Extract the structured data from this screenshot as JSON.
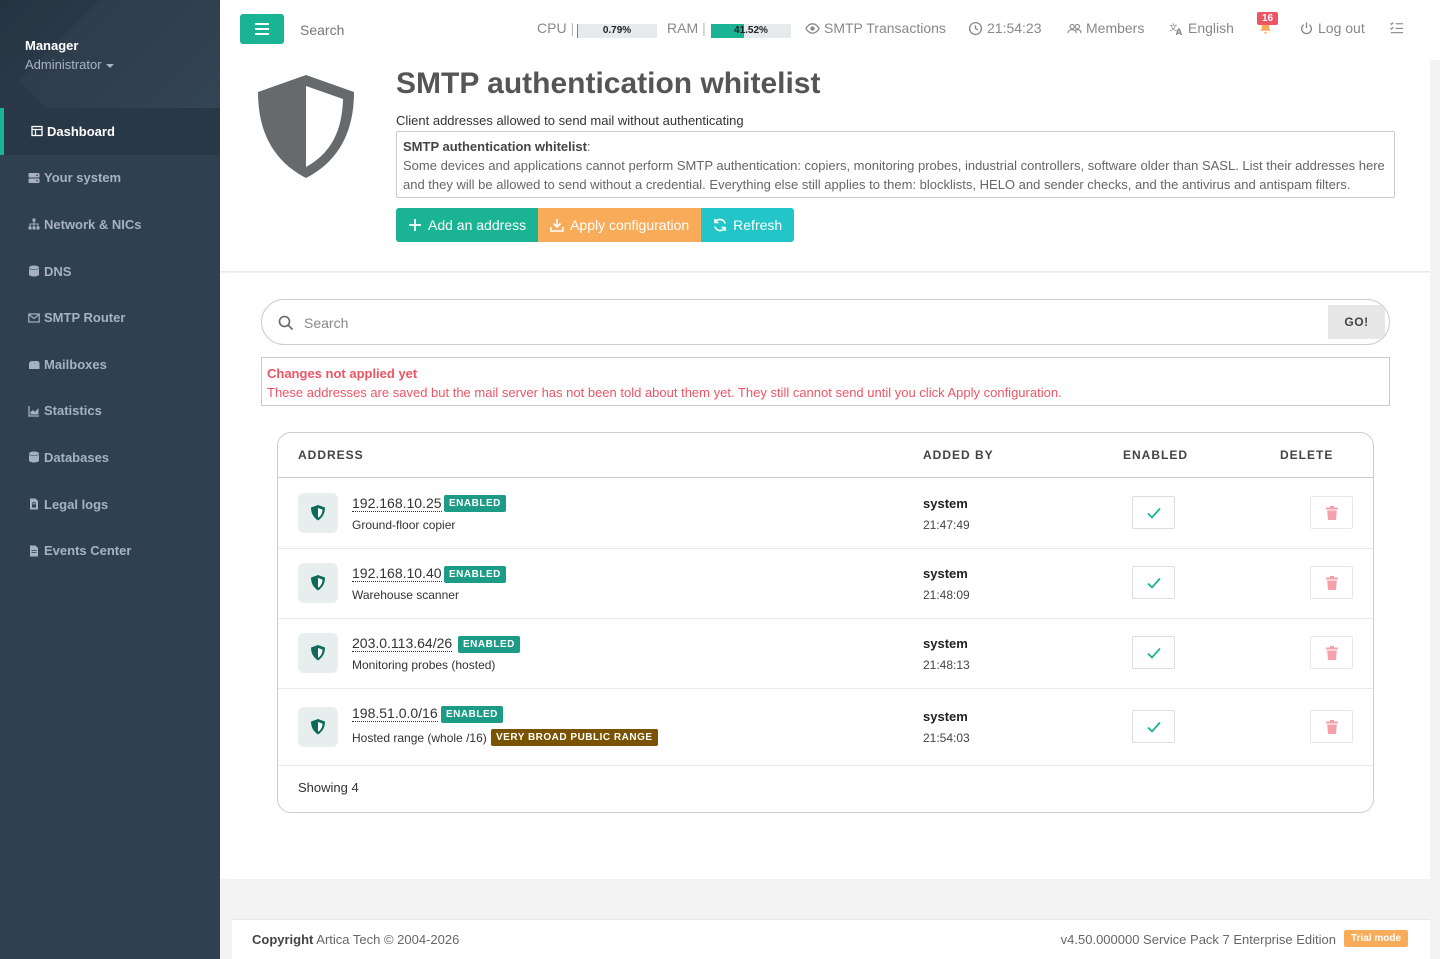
{
  "sidebar": {
    "user_name": "Manager",
    "user_role": "Administrator",
    "items": [
      {
        "label": "Dashboard",
        "icon": "dashboard-icon"
      },
      {
        "label": "Your system",
        "icon": "server-icon"
      },
      {
        "label": "Network & NICs",
        "icon": "network-icon"
      },
      {
        "label": "DNS",
        "icon": "database-icon"
      },
      {
        "label": "SMTP Router",
        "icon": "envelope-icon"
      },
      {
        "label": "Mailboxes",
        "icon": "mailbox-icon"
      },
      {
        "label": "Statistics",
        "icon": "chart-icon"
      },
      {
        "label": "Databases",
        "icon": "database-icon"
      },
      {
        "label": "Legal logs",
        "icon": "file-lock-icon"
      },
      {
        "label": "Events Center",
        "icon": "file-icon"
      }
    ]
  },
  "topbar": {
    "search_placeholder": "Search",
    "cpu_label": "CPU",
    "cpu_value": "0.79%",
    "cpu_fraction": 0.0079,
    "ram_label": "RAM",
    "ram_value": "41.52%",
    "ram_fraction": 0.4152,
    "smtp_transactions": "SMTP Transactions",
    "clock": "21:54:23",
    "members": "Members",
    "language": "English",
    "notifications": "16",
    "logout": "Log out"
  },
  "header": {
    "title": "SMTP authentication whitelist",
    "subtitle": "Client addresses allowed to send mail without authenticating",
    "explain_title": "SMTP authentication whitelist",
    "explain_text": "Some devices and applications cannot perform SMTP authentication: copiers, monitoring probes, industrial controllers, software older than SASL. List their addresses here and they will be allowed to send without a credential. Everything else still applies to them: blocklists, HELO and sender checks, and the antivirus and antispam filters.",
    "btn_add": "Add an address",
    "btn_apply": "Apply configuration",
    "btn_refresh": "Refresh"
  },
  "search": {
    "placeholder": "Search",
    "go_label": "GO!"
  },
  "alert": {
    "title": "Changes not applied yet",
    "text": "These addresses are saved but the mail server has not been told about them yet. They still cannot send until you click Apply configuration."
  },
  "table": {
    "headers": {
      "address": "ADDRESS",
      "added_by": "ADDED BY",
      "enabled": "ENABLED",
      "delete": "DELETE"
    },
    "rows": [
      {
        "address": "192.168.10.25",
        "badge": "ENABLED",
        "desc": "Ground-floor copier",
        "by": "system",
        "time": "21:47:49"
      },
      {
        "address": "192.168.10.40",
        "badge": "ENABLED",
        "desc": "Warehouse scanner",
        "by": "system",
        "time": "21:48:09"
      },
      {
        "address": "203.0.113.64/26",
        "badge": "ENABLED",
        "desc": "Monitoring probes (hosted)",
        "by": "system",
        "time": "21:48:13"
      },
      {
        "address": "198.51.0.0/16",
        "badge": "ENABLED",
        "desc": "Hosted range (whole /16) ·",
        "warn": "VERY BROAD PUBLIC RANGE",
        "by": "system",
        "time": "21:54:03"
      }
    ],
    "showing": "Showing 4"
  },
  "footer": {
    "copyright_label": "Copyright",
    "copyright_text": "Artica Tech © 2004-2026",
    "version": "v4.50.000000 Service Pack 7 Enterprise Edition",
    "trial": "Trial mode"
  },
  "colors": {
    "primary": "#1ab394",
    "warning": "#f8ac59",
    "info": "#23c6c8",
    "danger": "#ed5565",
    "sidebar": "#2f4050"
  }
}
